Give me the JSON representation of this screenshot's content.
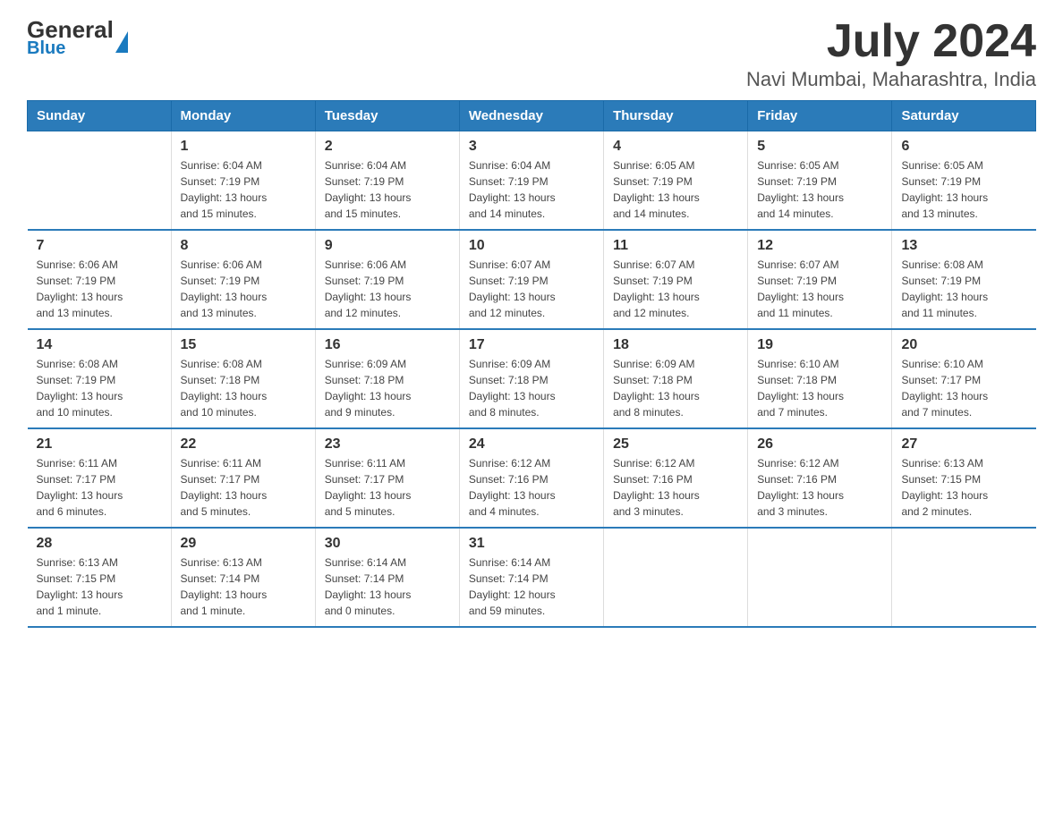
{
  "logo": {
    "line1": "General",
    "line2": "Blue"
  },
  "title": "July 2024",
  "location": "Navi Mumbai, Maharashtra, India",
  "days_of_week": [
    "Sunday",
    "Monday",
    "Tuesday",
    "Wednesday",
    "Thursday",
    "Friday",
    "Saturday"
  ],
  "weeks": [
    [
      {
        "day": "",
        "info": ""
      },
      {
        "day": "1",
        "info": "Sunrise: 6:04 AM\nSunset: 7:19 PM\nDaylight: 13 hours\nand 15 minutes."
      },
      {
        "day": "2",
        "info": "Sunrise: 6:04 AM\nSunset: 7:19 PM\nDaylight: 13 hours\nand 15 minutes."
      },
      {
        "day": "3",
        "info": "Sunrise: 6:04 AM\nSunset: 7:19 PM\nDaylight: 13 hours\nand 14 minutes."
      },
      {
        "day": "4",
        "info": "Sunrise: 6:05 AM\nSunset: 7:19 PM\nDaylight: 13 hours\nand 14 minutes."
      },
      {
        "day": "5",
        "info": "Sunrise: 6:05 AM\nSunset: 7:19 PM\nDaylight: 13 hours\nand 14 minutes."
      },
      {
        "day": "6",
        "info": "Sunrise: 6:05 AM\nSunset: 7:19 PM\nDaylight: 13 hours\nand 13 minutes."
      }
    ],
    [
      {
        "day": "7",
        "info": "Sunrise: 6:06 AM\nSunset: 7:19 PM\nDaylight: 13 hours\nand 13 minutes."
      },
      {
        "day": "8",
        "info": "Sunrise: 6:06 AM\nSunset: 7:19 PM\nDaylight: 13 hours\nand 13 minutes."
      },
      {
        "day": "9",
        "info": "Sunrise: 6:06 AM\nSunset: 7:19 PM\nDaylight: 13 hours\nand 12 minutes."
      },
      {
        "day": "10",
        "info": "Sunrise: 6:07 AM\nSunset: 7:19 PM\nDaylight: 13 hours\nand 12 minutes."
      },
      {
        "day": "11",
        "info": "Sunrise: 6:07 AM\nSunset: 7:19 PM\nDaylight: 13 hours\nand 12 minutes."
      },
      {
        "day": "12",
        "info": "Sunrise: 6:07 AM\nSunset: 7:19 PM\nDaylight: 13 hours\nand 11 minutes."
      },
      {
        "day": "13",
        "info": "Sunrise: 6:08 AM\nSunset: 7:19 PM\nDaylight: 13 hours\nand 11 minutes."
      }
    ],
    [
      {
        "day": "14",
        "info": "Sunrise: 6:08 AM\nSunset: 7:19 PM\nDaylight: 13 hours\nand 10 minutes."
      },
      {
        "day": "15",
        "info": "Sunrise: 6:08 AM\nSunset: 7:18 PM\nDaylight: 13 hours\nand 10 minutes."
      },
      {
        "day": "16",
        "info": "Sunrise: 6:09 AM\nSunset: 7:18 PM\nDaylight: 13 hours\nand 9 minutes."
      },
      {
        "day": "17",
        "info": "Sunrise: 6:09 AM\nSunset: 7:18 PM\nDaylight: 13 hours\nand 8 minutes."
      },
      {
        "day": "18",
        "info": "Sunrise: 6:09 AM\nSunset: 7:18 PM\nDaylight: 13 hours\nand 8 minutes."
      },
      {
        "day": "19",
        "info": "Sunrise: 6:10 AM\nSunset: 7:18 PM\nDaylight: 13 hours\nand 7 minutes."
      },
      {
        "day": "20",
        "info": "Sunrise: 6:10 AM\nSunset: 7:17 PM\nDaylight: 13 hours\nand 7 minutes."
      }
    ],
    [
      {
        "day": "21",
        "info": "Sunrise: 6:11 AM\nSunset: 7:17 PM\nDaylight: 13 hours\nand 6 minutes."
      },
      {
        "day": "22",
        "info": "Sunrise: 6:11 AM\nSunset: 7:17 PM\nDaylight: 13 hours\nand 5 minutes."
      },
      {
        "day": "23",
        "info": "Sunrise: 6:11 AM\nSunset: 7:17 PM\nDaylight: 13 hours\nand 5 minutes."
      },
      {
        "day": "24",
        "info": "Sunrise: 6:12 AM\nSunset: 7:16 PM\nDaylight: 13 hours\nand 4 minutes."
      },
      {
        "day": "25",
        "info": "Sunrise: 6:12 AM\nSunset: 7:16 PM\nDaylight: 13 hours\nand 3 minutes."
      },
      {
        "day": "26",
        "info": "Sunrise: 6:12 AM\nSunset: 7:16 PM\nDaylight: 13 hours\nand 3 minutes."
      },
      {
        "day": "27",
        "info": "Sunrise: 6:13 AM\nSunset: 7:15 PM\nDaylight: 13 hours\nand 2 minutes."
      }
    ],
    [
      {
        "day": "28",
        "info": "Sunrise: 6:13 AM\nSunset: 7:15 PM\nDaylight: 13 hours\nand 1 minute."
      },
      {
        "day": "29",
        "info": "Sunrise: 6:13 AM\nSunset: 7:14 PM\nDaylight: 13 hours\nand 1 minute."
      },
      {
        "day": "30",
        "info": "Sunrise: 6:14 AM\nSunset: 7:14 PM\nDaylight: 13 hours\nand 0 minutes."
      },
      {
        "day": "31",
        "info": "Sunrise: 6:14 AM\nSunset: 7:14 PM\nDaylight: 12 hours\nand 59 minutes."
      },
      {
        "day": "",
        "info": ""
      },
      {
        "day": "",
        "info": ""
      },
      {
        "day": "",
        "info": ""
      }
    ]
  ]
}
